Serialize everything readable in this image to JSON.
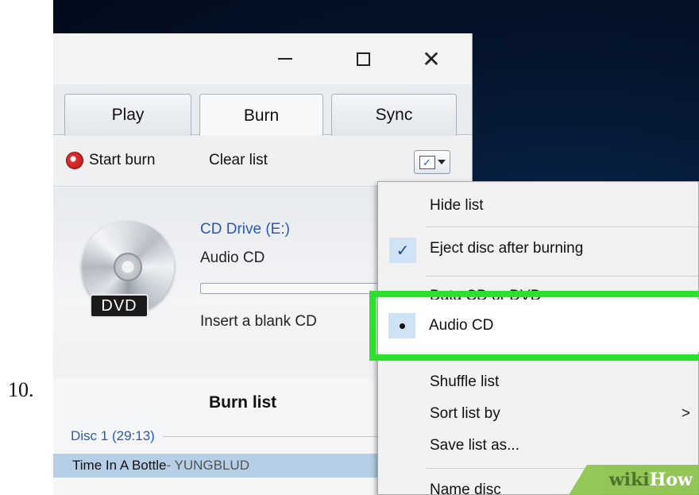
{
  "step": {
    "number": "10."
  },
  "window": {
    "controls": {
      "minimize": "—",
      "close": "✕"
    },
    "tabs": [
      {
        "label": "Play"
      },
      {
        "label": "Burn"
      },
      {
        "label": "Sync"
      }
    ],
    "toolbar": {
      "start_burn": "Start burn",
      "clear_list": "Clear list"
    },
    "drive": {
      "name": "CD Drive (E:)",
      "type": "Audio CD",
      "badge": "DVD",
      "progress": 0,
      "message": "Insert a blank CD"
    },
    "burn_list": {
      "title": "Burn list",
      "disc": "Disc 1 (29:13)",
      "tracks": [
        {
          "title": "Time In A Bottle",
          "artist": " - YUNGBLUD"
        }
      ]
    }
  },
  "menu": {
    "items": [
      {
        "label": "Hide list"
      },
      {
        "label": "Eject disc after burning",
        "checked": true
      },
      {
        "label": "Data CD or DVD"
      },
      {
        "label": "Audio CD",
        "selected": true
      },
      {
        "label": "Shuffle list"
      },
      {
        "label": "Sort list by",
        "submenu": ">"
      },
      {
        "label": "Save list as..."
      },
      {
        "label": "Name disc"
      }
    ]
  },
  "icons": {
    "burn": "burn-icon",
    "options": "list-options-icon",
    "check": "checkmark-icon"
  },
  "colors": {
    "highlight": "#2de02d",
    "link": "#2b57b8",
    "selection": "#b6cfe6"
  },
  "watermark": {
    "wiki": "wiki",
    "how": "How"
  }
}
